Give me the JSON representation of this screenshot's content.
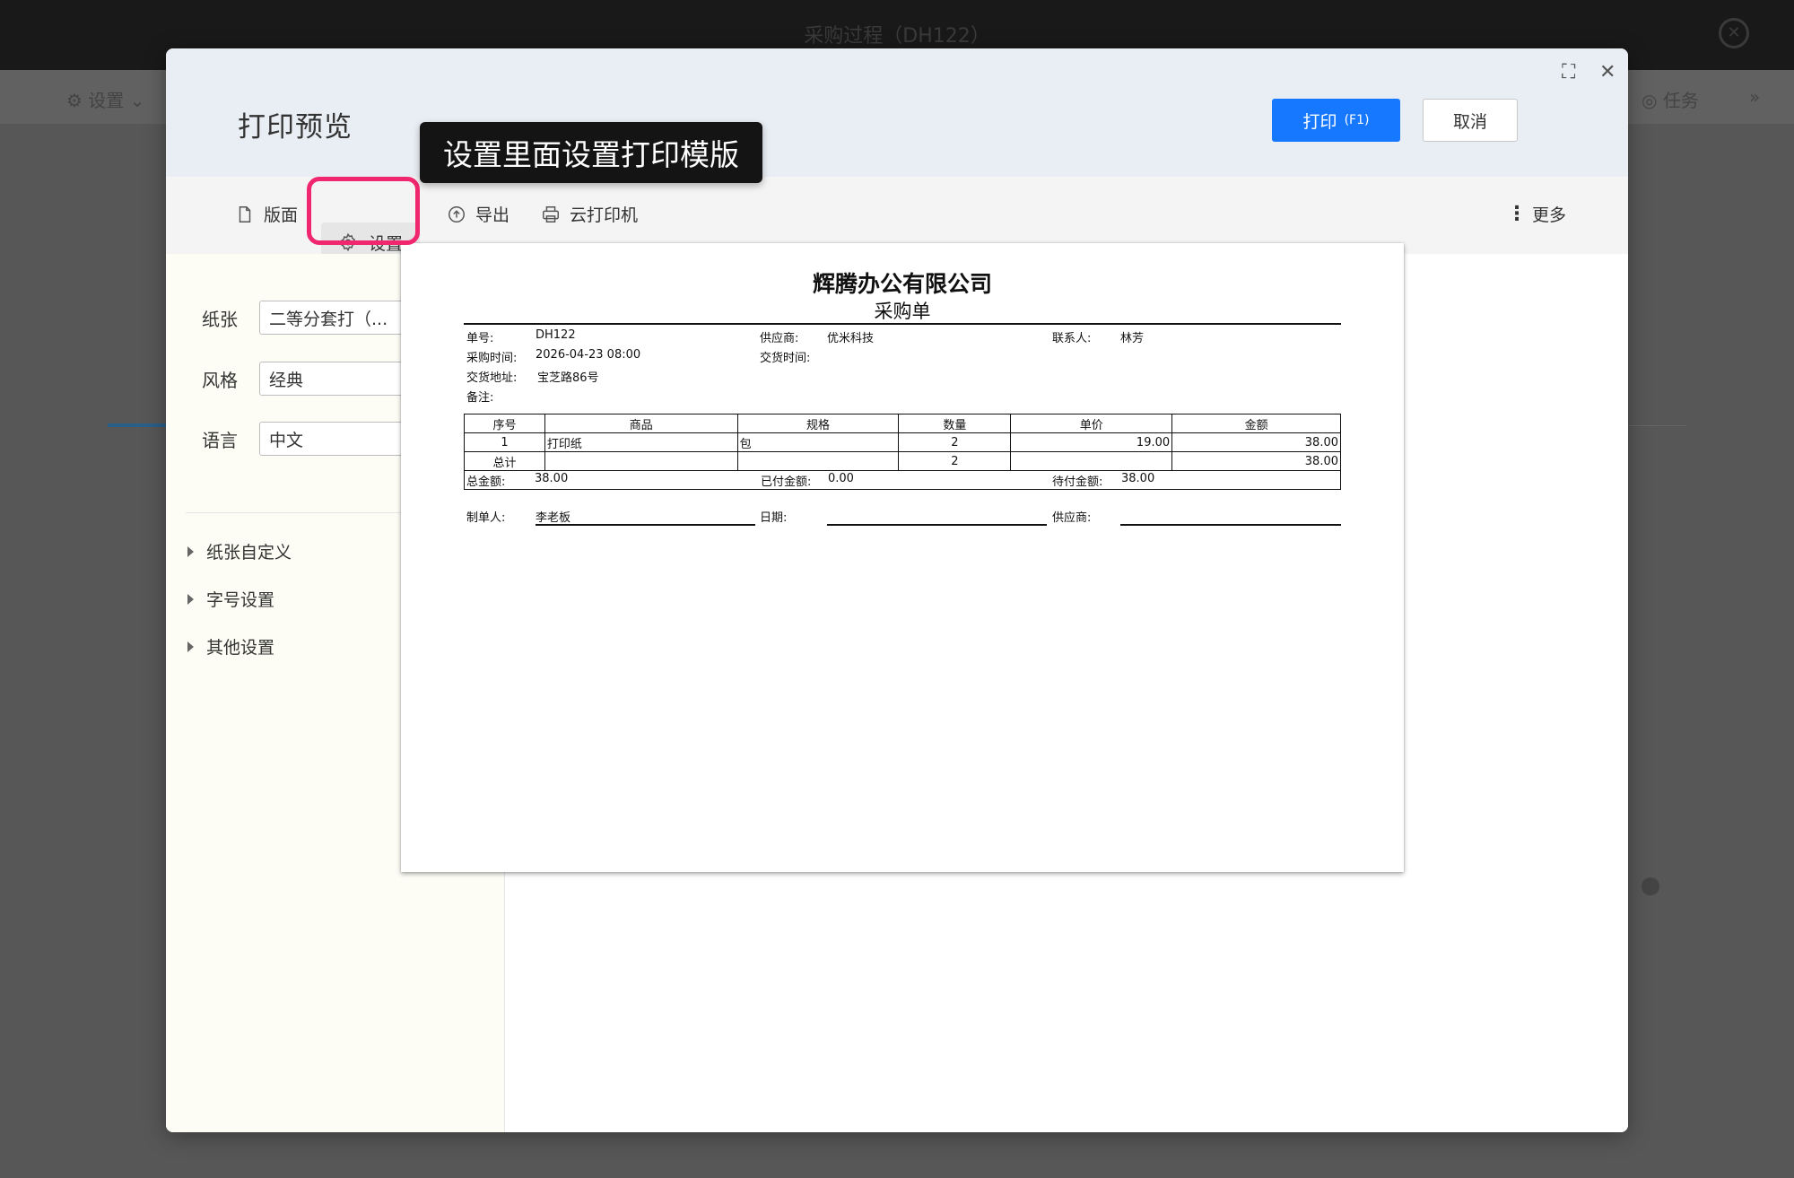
{
  "background": {
    "title": "采购过程（DH122）",
    "tool_left": "设置",
    "tool_right": "任务"
  },
  "modal": {
    "title": "打印预览",
    "print_label": "打印",
    "print_shortcut": "(F1)",
    "cancel_label": "取消"
  },
  "tooltip": "设置里面设置打印模版",
  "toolbar": {
    "layout": "版面",
    "settings": "设置",
    "export": "导出",
    "cloud_print": "云打印机",
    "more": "更多"
  },
  "sidebar": {
    "paper_label": "纸张",
    "paper_value": "二等分套打（...",
    "style_label": "风格",
    "style_value": "经典",
    "language_label": "语言",
    "language_value": "中文",
    "sections": [
      "纸张自定义",
      "字号设置",
      "其他设置"
    ]
  },
  "document": {
    "company": "辉腾办公有限公司",
    "doc_type": "采购单",
    "order_no_label": "单号:",
    "order_no": "DH122",
    "supplier_label": "供应商:",
    "supplier": "优米科技",
    "contact_label": "联系人:",
    "contact": "林芳",
    "purchase_time_label": "采购时间:",
    "purchase_time": "2026-04-23 08:00",
    "delivery_time_label": "交货时间:",
    "delivery_addr_label": "交货地址:",
    "delivery_addr": "宝芝路86号",
    "remark_label": "备注:",
    "columns": [
      "序号",
      "商品",
      "规格",
      "数量",
      "单价",
      "金额"
    ],
    "row": {
      "no": "1",
      "product": "打印纸",
      "spec": "包",
      "qty": "2",
      "price": "19.00",
      "amount": "38.00"
    },
    "total_label": "总计",
    "total_qty": "2",
    "total_amount": "38.00",
    "total_amount_label": "总金额:",
    "total_amount_value": "38.00",
    "paid_label": "已付金额:",
    "paid_value": "0.00",
    "due_label": "待付金额:",
    "due_value": "38.00",
    "maker_label": "制单人:",
    "maker": "李老板",
    "date_label": "日期:",
    "supplier_sign_label": "供应商:"
  }
}
